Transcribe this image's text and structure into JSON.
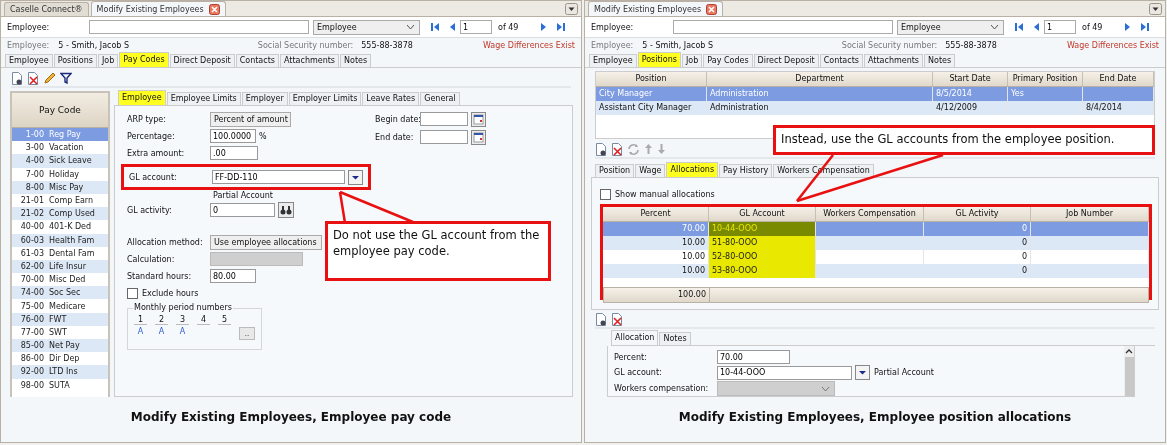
{
  "left_panel": {
    "window_tabs": [
      {
        "label": "Caselle Connect®",
        "selected": false,
        "closable": false
      },
      {
        "label": "Modify Existing Employees",
        "selected": true,
        "closable": true
      }
    ],
    "lookup": {
      "label": "Employee:",
      "search_by": "Employee",
      "record": "1",
      "record_count": "of 49"
    },
    "employee": {
      "label": "Employee:",
      "value": "5 - Smith, Jacob S",
      "ssn_label": "Social Security number:",
      "ssn_value": "555-88-3878",
      "warning": "Wage Differences Exist"
    },
    "tabs": [
      {
        "label": "Employee",
        "selected": false
      },
      {
        "label": "Positions",
        "selected": false
      },
      {
        "label": "Job",
        "selected": false
      },
      {
        "label": "Pay Codes",
        "selected": true
      },
      {
        "label": "Direct Deposit",
        "selected": false
      },
      {
        "label": "Contacts",
        "selected": false
      },
      {
        "label": "Attachments",
        "selected": false
      },
      {
        "label": "Notes",
        "selected": false
      }
    ],
    "pay_codes": {
      "header": "Pay Code",
      "items": [
        {
          "code": "1-00",
          "name": "Reg Pay",
          "selected": true
        },
        {
          "code": "3-00",
          "name": "Vacation",
          "selected": false
        },
        {
          "code": "4-00",
          "name": "Sick Leave",
          "selected": false
        },
        {
          "code": "7-00",
          "name": "Holiday",
          "selected": false
        },
        {
          "code": "8-00",
          "name": "Misc Pay",
          "selected": false
        },
        {
          "code": "21-01",
          "name": "Comp Earn",
          "selected": false
        },
        {
          "code": "21-02",
          "name": "Comp Used",
          "selected": false
        },
        {
          "code": "40-00",
          "name": "401-K Ded",
          "selected": false
        },
        {
          "code": "60-03",
          "name": "Health Fam",
          "selected": false
        },
        {
          "code": "61-03",
          "name": "Dental Fam",
          "selected": false
        },
        {
          "code": "62-00",
          "name": "Life Insur",
          "selected": false
        },
        {
          "code": "70-00",
          "name": "Misc Ded",
          "selected": false
        },
        {
          "code": "74-00",
          "name": "Soc Sec",
          "selected": false
        },
        {
          "code": "75-00",
          "name": "Medicare",
          "selected": false
        },
        {
          "code": "76-00",
          "name": "FWT",
          "selected": false
        },
        {
          "code": "77-00",
          "name": "SWT",
          "selected": false
        },
        {
          "code": "85-00",
          "name": "Net Pay",
          "selected": false
        },
        {
          "code": "86-00",
          "name": "Dir Dep",
          "selected": false
        },
        {
          "code": "92-00",
          "name": "LTD Ins",
          "selected": false
        },
        {
          "code": "98-00",
          "name": "SUTA",
          "selected": false
        }
      ]
    },
    "sub_tabs": [
      {
        "label": "Employee",
        "selected": true
      },
      {
        "label": "Employee Limits",
        "selected": false
      },
      {
        "label": "Employer",
        "selected": false
      },
      {
        "label": "Employer Limits",
        "selected": false
      },
      {
        "label": "Leave Rates",
        "selected": false
      },
      {
        "label": "General",
        "selected": false
      }
    ],
    "form": {
      "arp_type": {
        "label": "ARP type:",
        "value": "Percent of amount"
      },
      "percentage": {
        "label": "Percentage:",
        "value": "100.0000",
        "unit": "%"
      },
      "extra_amount": {
        "label": "Extra amount:",
        "value": ".00"
      },
      "gl_account": {
        "label": "GL account:",
        "value": "FF-DD-110",
        "hint": "Partial Account",
        "highlighted": true
      },
      "gl_activity": {
        "label": "GL activity:",
        "value": "0"
      },
      "allocation_method": {
        "label": "Allocation method:",
        "value": "Use employee allocations"
      },
      "calculation": {
        "label": "Calculation:",
        "disabled": true
      },
      "standard_hours": {
        "label": "Standard hours:",
        "value": "80.00"
      },
      "exclude_hours": {
        "label": "Exclude hours",
        "checked": false
      },
      "begin_date": {
        "label": "Begin date:"
      },
      "end_date": {
        "label": "End date:"
      },
      "monthly_periods": {
        "title": "Monthly period numbers",
        "button": "..",
        "periods": [
          {
            "number": "1",
            "value": "A"
          },
          {
            "number": "2",
            "value": "A"
          },
          {
            "number": "3",
            "value": "A"
          },
          {
            "number": "4"
          },
          {
            "number": "5"
          }
        ]
      }
    },
    "callout": "Do not use the GL account from the employee pay code.",
    "caption": "Modify Existing Employees, Employee pay code"
  },
  "right_panel": {
    "window_tabs": [
      {
        "label": "Modify Existing Employees",
        "selected": true,
        "closable": true
      }
    ],
    "lookup": {
      "label": "Employee:",
      "search_by": "Employee",
      "record": "1",
      "record_count": "of 49"
    },
    "employee": {
      "label": "Employee:",
      "value": "5 - Smith, Jacob S",
      "ssn_label": "Social Security number:",
      "ssn_value": "555-88-3878",
      "warning": "Wage Differences Exist"
    },
    "tabs": [
      {
        "label": "Employee",
        "selected": false
      },
      {
        "label": "Positions",
        "selected": true
      },
      {
        "label": "Job",
        "selected": false
      },
      {
        "label": "Pay Codes",
        "selected": false
      },
      {
        "label": "Direct Deposit",
        "selected": false
      },
      {
        "label": "Contacts",
        "selected": false
      },
      {
        "label": "Attachments",
        "selected": false
      },
      {
        "label": "Notes",
        "selected": false
      }
    ],
    "positions": {
      "columns": [
        "Position",
        "Department",
        "Start Date",
        "Primary Position",
        "End Date"
      ],
      "rows": [
        {
          "position": "City Manager",
          "department": "Administration",
          "start_date": "8/5/2014",
          "primary_position": "Yes",
          "selected": true
        },
        {
          "position": "Assistant City Manager",
          "department": "Administration",
          "start_date": "4/12/2009",
          "end_date": "8/4/2014",
          "selected": false
        }
      ]
    },
    "sub_tabs": [
      {
        "label": "Position",
        "selected": false
      },
      {
        "label": "Wage",
        "selected": false
      },
      {
        "label": "Allocations",
        "selected": true
      },
      {
        "label": "Pay History",
        "selected": false
      },
      {
        "label": "Workers Compensation",
        "selected": false
      }
    ],
    "show_manual": {
      "label": "Show manual allocations",
      "checked": false
    },
    "allocations": {
      "columns": [
        "Percent",
        "GL Account",
        "Workers Compensation",
        "GL Activity",
        "Job Number"
      ],
      "total": "100.00",
      "rows": [
        {
          "percent": "70.00",
          "gl_account": "10-44-OOO",
          "gl_activity": "0",
          "selected": true,
          "highlighted": true
        },
        {
          "percent": "10.00",
          "gl_account": "51-80-OOO",
          "gl_activity": "0",
          "selected": false,
          "highlighted": true
        },
        {
          "percent": "10.00",
          "gl_account": "52-80-OOO",
          "gl_activity": "0",
          "selected": false,
          "highlighted": true
        },
        {
          "percent": "10.00",
          "gl_account": "53-80-OOO",
          "gl_activity": "0",
          "selected": false,
          "highlighted": true
        }
      ]
    },
    "detail_tabs": [
      {
        "label": "Allocation",
        "selected": true
      },
      {
        "label": "Notes",
        "selected": false
      }
    ],
    "detail": {
      "percent": {
        "label": "Percent:",
        "value": "70.00"
      },
      "gl_account": {
        "label": "GL account:",
        "value": "10-44-OOO",
        "hint": "Partial Account"
      },
      "workers_compensation": {
        "label": "Workers compensation:",
        "disabled": true
      }
    },
    "callout": "Instead, use the GL accounts from the employee position.",
    "caption": "Modify Existing Employees, Employee position allocations"
  }
}
